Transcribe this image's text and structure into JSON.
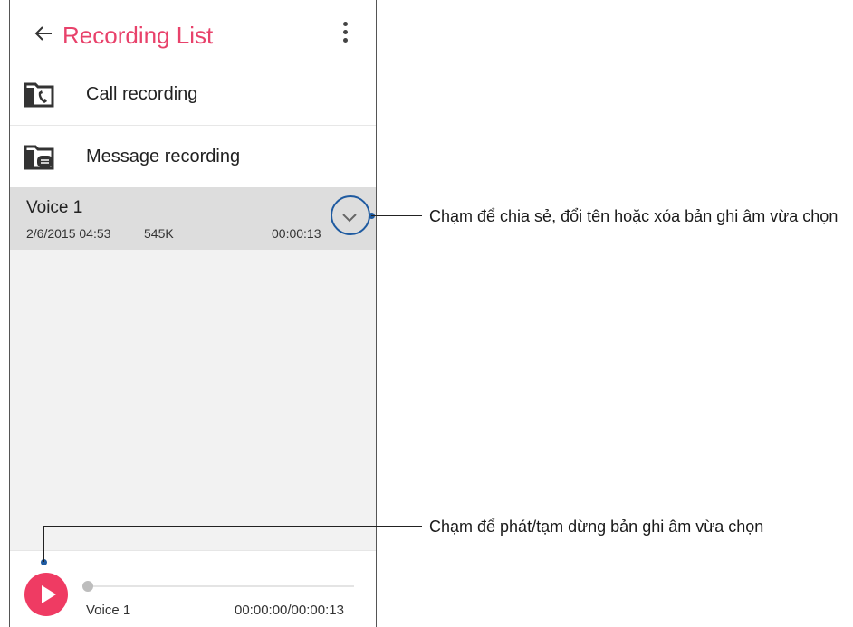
{
  "appbar": {
    "title": "Recording List",
    "back_icon": "arrow-left-icon",
    "menu_icon": "more-vert-icon"
  },
  "folders": [
    {
      "label": "Call recording",
      "icon": "call-folder-icon"
    },
    {
      "label": "Message recording",
      "icon": "message-folder-icon"
    }
  ],
  "recording": {
    "name": "Voice 1",
    "date": "2/6/2015 04:53",
    "size": "545K",
    "duration": "00:00:13",
    "expand_icon": "chevron-down-icon"
  },
  "player": {
    "name": "Voice 1",
    "time": "00:00:00/00:00:13",
    "progress": 0,
    "play_icon": "play-icon"
  },
  "callouts": {
    "expand": "Chạm để chia sẻ, đổi tên hoặc xóa bản ghi âm vừa chọn",
    "play": "Chạm để phát/tạm dừng bản ghi âm vừa chọn"
  },
  "colors": {
    "accent": "#e8426b",
    "play_button": "#ef3b63",
    "callout": "#1e5aa0"
  }
}
